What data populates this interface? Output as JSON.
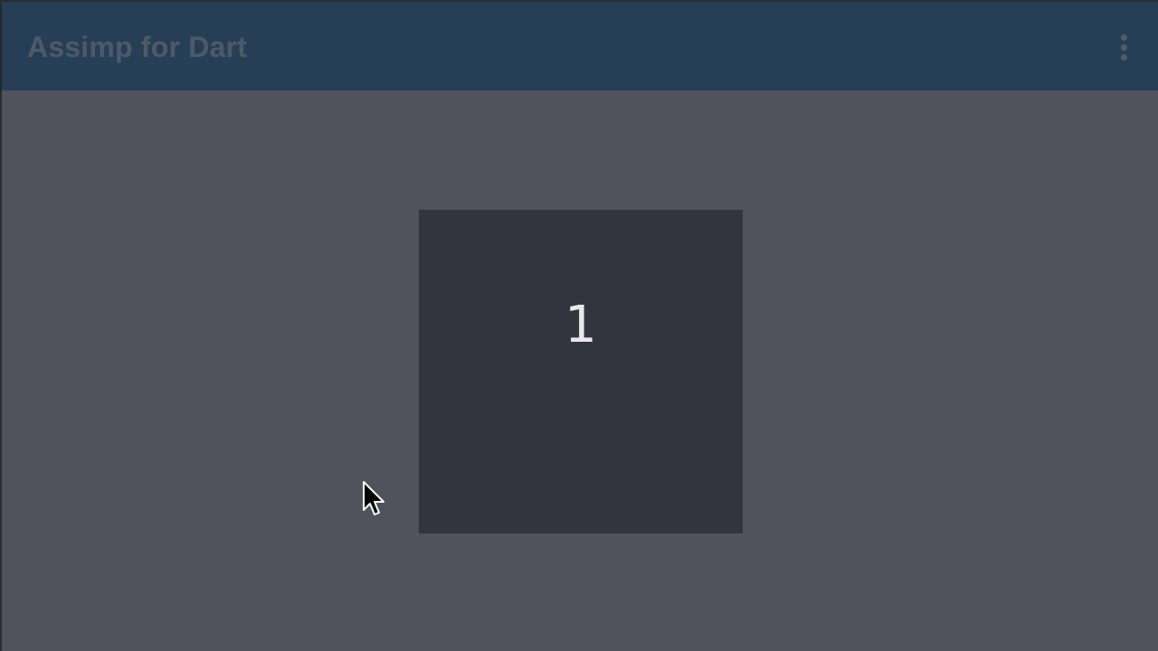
{
  "app_bar": {
    "title": "Assimp for Dart",
    "menu_icon": "more-vert-icon",
    "background_color": "#273e57"
  },
  "content": {
    "background_color": "#50535c",
    "card": {
      "label": "1",
      "background_color": "#33353e"
    }
  },
  "cursor": {
    "icon": "mouse-pointer-icon"
  }
}
